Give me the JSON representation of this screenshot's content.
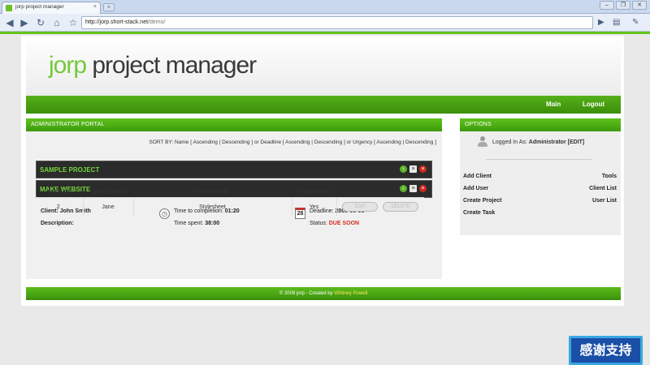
{
  "browser": {
    "tab_title": "jorp project manager",
    "tab_close": "×",
    "new_tab": "+",
    "window_buttons": [
      "–",
      "❐",
      "✕"
    ],
    "url_host": "http://jorp.short-stack.net",
    "url_path": "/demo/"
  },
  "header": {
    "logo_jorp": "jorp",
    "logo_rest": " project manager"
  },
  "nav": {
    "main": "Main",
    "logout": "Logout"
  },
  "admin_portal": {
    "title": "ADMINISTRATOR PORTAL",
    "sort_bar": "SORT BY: Name [ Ascending | Descending ] or Deadline [ Ascending | Descending ] or Urgency [ Ascending | Descending ]",
    "projects": [
      {
        "name": "SAMPLE PROJECT"
      },
      {
        "name": "MAKE WEBSITE"
      }
    ],
    "detail": {
      "client_label": "Client:",
      "client": "John Smith",
      "description_label": "Description:",
      "time_to_completion_label": "Time to completion:",
      "time_to_completion": "01:20",
      "time_spent_label": "Time spent:",
      "time_spent": "38:00",
      "deadline_label": "Deadline:",
      "deadline": "2009-05-08",
      "status_label": "Status:",
      "status": "DUE SOON",
      "calendar_day": "28"
    },
    "tasks": {
      "headers": [
        "TASK ID",
        "DEVELOPER",
        "TASK NAME",
        "COMPLETE"
      ],
      "rows": [
        {
          "id": "2",
          "developer": "Jane",
          "name": "Stylesheet",
          "complete": "Yes"
        }
      ],
      "edit_label": "EDIT",
      "delete_label": "DELETE"
    }
  },
  "options": {
    "title": "OPTIONS",
    "logged_in_label": "Logged In As:",
    "logged_in_user": "Administrator",
    "edit_link": "[EDIT]",
    "left_links": [
      "Add Client",
      "Add User",
      "Create Project",
      "Create Task"
    ],
    "right_links": [
      "Tools",
      "Client List",
      "User List"
    ]
  },
  "footer": {
    "text": "© 2009 jorp - Created by ",
    "author": "Whitney Powell"
  },
  "badge": {
    "text": "感谢支持"
  }
}
